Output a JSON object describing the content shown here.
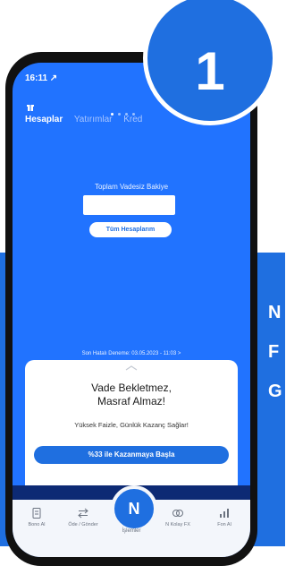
{
  "side_text": [
    "N",
    "F",
    "G"
  ],
  "badge": {
    "number": "1"
  },
  "status_bar": {
    "time": "16:11 ↗"
  },
  "tabs": [
    {
      "label": "Hesaplar",
      "active": true
    },
    {
      "label": "Yatırımlar",
      "active": false
    },
    {
      "label": "Kred",
      "active": false
    }
  ],
  "balance": {
    "label": "Toplam Vadesiz Bakiye",
    "button_label": "Tüm Hesaplarım"
  },
  "last_login": "Son Hatalı Deneme: 03.05.2023 - 11:03 >",
  "promo": {
    "title_line1": "Vade Bekletmez,",
    "title_line2": "Masraf Almaz!",
    "subtitle": "Yüksek Faizle, Günlük Kazanç Sağlar!",
    "cta_label": "%33 ile Kazanmaya Başla"
  },
  "nav": {
    "items": [
      {
        "label": "Bono Al",
        "icon": "document-icon"
      },
      {
        "label": "Öde / Gönder",
        "icon": "transfer-icon"
      },
      {
        "label": "İşlemler",
        "icon": "n-logo-icon"
      },
      {
        "label": "N Kolay FX",
        "icon": "fx-icon"
      },
      {
        "label": "Fon Al",
        "icon": "chart-icon"
      }
    ],
    "center_glyph": "N"
  },
  "colors": {
    "brand_blue": "#1f6fe0",
    "screen_blue": "#2173ff",
    "dark_band": "#0d2a74"
  }
}
